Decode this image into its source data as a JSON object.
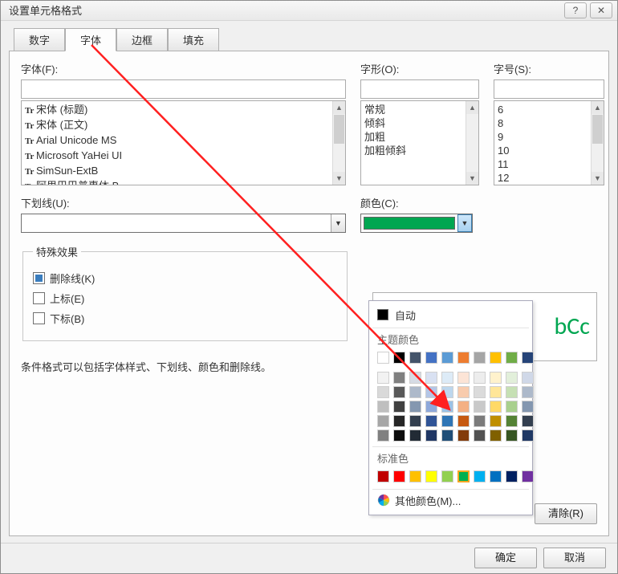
{
  "title": "设置单元格格式",
  "title_help_glyph": "?",
  "title_close_glyph": "✕",
  "tabs": {
    "number": "数字",
    "font": "字体",
    "border": "边框",
    "fill": "填充"
  },
  "labels": {
    "font": "字体(F):",
    "style": "字形(O):",
    "size": "字号(S):",
    "underline": "下划线(U):",
    "color": "颜色(C):"
  },
  "font_list": [
    "宋体 (标题)",
    "宋体 (正文)",
    "Arial Unicode MS",
    "Microsoft YaHei UI",
    "SimSun-ExtB",
    "阿里巴巴普惠体 B"
  ],
  "style_list": [
    "常规",
    "倾斜",
    "加粗",
    "加粗倾斜"
  ],
  "size_list": [
    "6",
    "8",
    "9",
    "10",
    "11",
    "12"
  ],
  "effects": {
    "legend": "特殊效果",
    "strike": "删除线(K)",
    "superscript": "上标(E)",
    "subscript": "下标(B)"
  },
  "hint": "条件格式可以包括字体样式、下划线、颜色和删除线。",
  "color_swatch": "#00A651",
  "preview_text": "bCc",
  "popup": {
    "auto": "自动",
    "theme": "主题颜色",
    "standard": "标准色",
    "more": "其他颜色(M)...",
    "theme_row": [
      "#FFFFFF",
      "#000000",
      "#44546A",
      "#4472C4",
      "#5B9BD5",
      "#ED7D31",
      "#A5A5A5",
      "#FFC000",
      "#70AD47",
      "#264478"
    ],
    "theme_shades": [
      [
        "#F2F2F2",
        "#808080",
        "#D6DCE5",
        "#D9E1F2",
        "#DDEBF7",
        "#FCE4D6",
        "#EDEDED",
        "#FFF2CC",
        "#E2EFDA",
        "#D0D8E8"
      ],
      [
        "#D9D9D9",
        "#595959",
        "#ADB9CA",
        "#B4C6E7",
        "#BDD7EE",
        "#F8CBAD",
        "#DBDBDB",
        "#FFE699",
        "#C6E0B4",
        "#ADB9CA"
      ],
      [
        "#BFBFBF",
        "#404040",
        "#8497B0",
        "#8EA9DB",
        "#9BC2E6",
        "#F4B084",
        "#C9C9C9",
        "#FFD966",
        "#A9D08E",
        "#8497B0"
      ],
      [
        "#A6A6A6",
        "#262626",
        "#333F4F",
        "#305496",
        "#2F75B5",
        "#C65911",
        "#7B7B7B",
        "#BF8F00",
        "#548235",
        "#333F4F"
      ],
      [
        "#808080",
        "#0D0D0D",
        "#222B35",
        "#203764",
        "#1F4E78",
        "#833C0C",
        "#525252",
        "#806000",
        "#375623",
        "#1F3864"
      ]
    ],
    "standard_row": [
      "#C00000",
      "#FF0000",
      "#FFC000",
      "#FFFF00",
      "#92D050",
      "#00B050",
      "#00B0F0",
      "#0070C0",
      "#002060",
      "#7030A0"
    ]
  },
  "buttons": {
    "clear": "清除(R)",
    "ok": "确定",
    "cancel": "取消"
  },
  "tt_glyph": "Tr",
  "arrow_glyphs": {
    "up": "▲",
    "down": "▼"
  }
}
